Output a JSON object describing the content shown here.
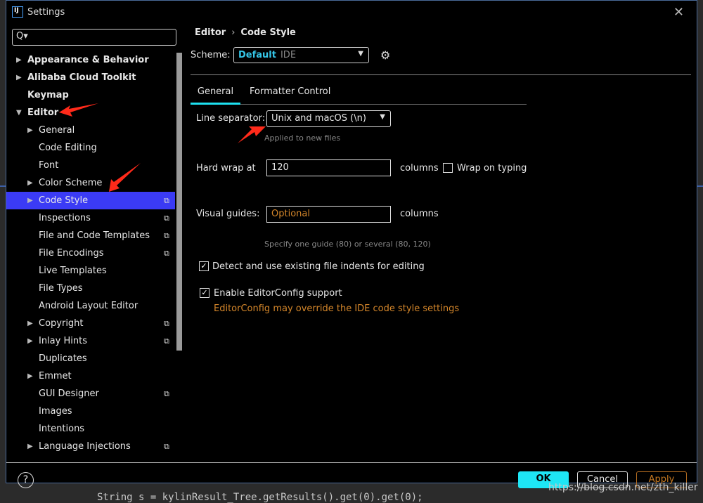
{
  "window": {
    "title": "Settings",
    "close": "✕",
    "app_icon": "IJ"
  },
  "search": {
    "icon": "Q▾",
    "value": ""
  },
  "tree": [
    {
      "label": "Appearance & Behavior",
      "level": 0,
      "expand": "▶",
      "top": true
    },
    {
      "label": "Alibaba Cloud Toolkit",
      "level": 0,
      "expand": "▶",
      "top": true
    },
    {
      "label": "Keymap",
      "level": 0,
      "top": true
    },
    {
      "label": "Editor",
      "level": 0,
      "expand": "▼",
      "top": true
    },
    {
      "label": "General",
      "level": 1,
      "expand": "▶"
    },
    {
      "label": "Code Editing",
      "level": 1
    },
    {
      "label": "Font",
      "level": 1
    },
    {
      "label": "Color Scheme",
      "level": 1,
      "expand": "▶"
    },
    {
      "label": "Code Style",
      "level": 1,
      "expand": "▶",
      "copy": true,
      "selected": true
    },
    {
      "label": "Inspections",
      "level": 1,
      "copy": true
    },
    {
      "label": "File and Code Templates",
      "level": 1,
      "copy": true
    },
    {
      "label": "File Encodings",
      "level": 1,
      "copy": true
    },
    {
      "label": "Live Templates",
      "level": 1
    },
    {
      "label": "File Types",
      "level": 1
    },
    {
      "label": "Android Layout Editor",
      "level": 1
    },
    {
      "label": "Copyright",
      "level": 1,
      "expand": "▶",
      "copy": true
    },
    {
      "label": "Inlay Hints",
      "level": 1,
      "expand": "▶",
      "copy": true
    },
    {
      "label": "Duplicates",
      "level": 1
    },
    {
      "label": "Emmet",
      "level": 1,
      "expand": "▶"
    },
    {
      "label": "GUI Designer",
      "level": 1,
      "copy": true
    },
    {
      "label": "Images",
      "level": 1
    },
    {
      "label": "Intentions",
      "level": 1
    },
    {
      "label": "Language Injections",
      "level": 1,
      "expand": "▶",
      "copy": true
    }
  ],
  "breadcrumb": {
    "parent": "Editor",
    "sep": "›",
    "current": "Code Style"
  },
  "scheme": {
    "label": "Scheme:",
    "name": "Default",
    "type": "IDE"
  },
  "tabs": [
    "General",
    "Formatter Control"
  ],
  "general": {
    "line_sep_label": "Line separator:",
    "line_sep_value": "Unix and macOS (\\n)",
    "line_sep_hint": "Applied to new files",
    "hard_wrap_label": "Hard wrap at",
    "hard_wrap_value": "120",
    "columns": "columns",
    "wrap_typing": "Wrap on typing",
    "guides_label": "Visual guides:",
    "guides_placeholder": "Optional",
    "guides_hint": "Specify one guide (80) or several (80, 120)",
    "detect_indents": "Detect and use existing file indents for editing",
    "editorconfig": "Enable EditorConfig support",
    "editorconfig_warn": "EditorConfig may override the IDE code style settings",
    "check": "✓"
  },
  "buttons": {
    "help": "?",
    "ok": "OK",
    "cancel": "Cancel",
    "apply": "Apply"
  },
  "background_code": "String s = kylinResult_Tree.getResults().get(0).get(0);",
  "watermark": "https://blog.csdn.net/zth_killer",
  "colors": {
    "accent": "#1ee6f5",
    "selection": "#3b3bf5",
    "warning": "#d4862a",
    "annotation": "#ff2a1a"
  }
}
